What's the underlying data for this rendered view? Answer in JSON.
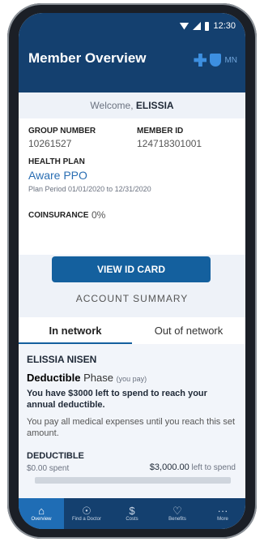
{
  "status": {
    "time": "12:30"
  },
  "header": {
    "title": "Member Overview",
    "region": "MN"
  },
  "welcome": {
    "prefix": "Welcome,",
    "name": "ELISSIA"
  },
  "member": {
    "group_label": "GROUP NUMBER",
    "group_value": "10261527",
    "member_label": "MEMBER ID",
    "member_value": "124718301001",
    "plan_label": "HEALTH PLAN",
    "plan_name": "Aware PPO",
    "period_label": "Plan Period",
    "period_value": "01/01/2020 to 12/31/2020",
    "coins_label": "COINSURANCE",
    "coins_value": "0%"
  },
  "id_button": "VIEW ID CARD",
  "account": {
    "title": "ACCOUNT SUMMARY",
    "tabs": [
      "In network",
      "Out of network"
    ]
  },
  "deductible": {
    "person": "ELISSIA NISEN",
    "title_a": "Deductible",
    "title_b": "Phase",
    "title_c": "(you pay)",
    "message": "You have $3000 left to spend to reach your annual deductible.",
    "sub": "You pay all medical expenses until you reach this set amount.",
    "label": "DEDUCTIBLE",
    "spent": "$0.00 spent",
    "left_amount": "$3,000.00",
    "left_text": "left to spend"
  },
  "nav": [
    {
      "label": "Overview",
      "icon": "⌂"
    },
    {
      "label": "Find a Doctor",
      "icon": "☉"
    },
    {
      "label": "Costs",
      "icon": "$"
    },
    {
      "label": "Benefits",
      "icon": "♡"
    },
    {
      "label": "More",
      "icon": "···"
    }
  ]
}
